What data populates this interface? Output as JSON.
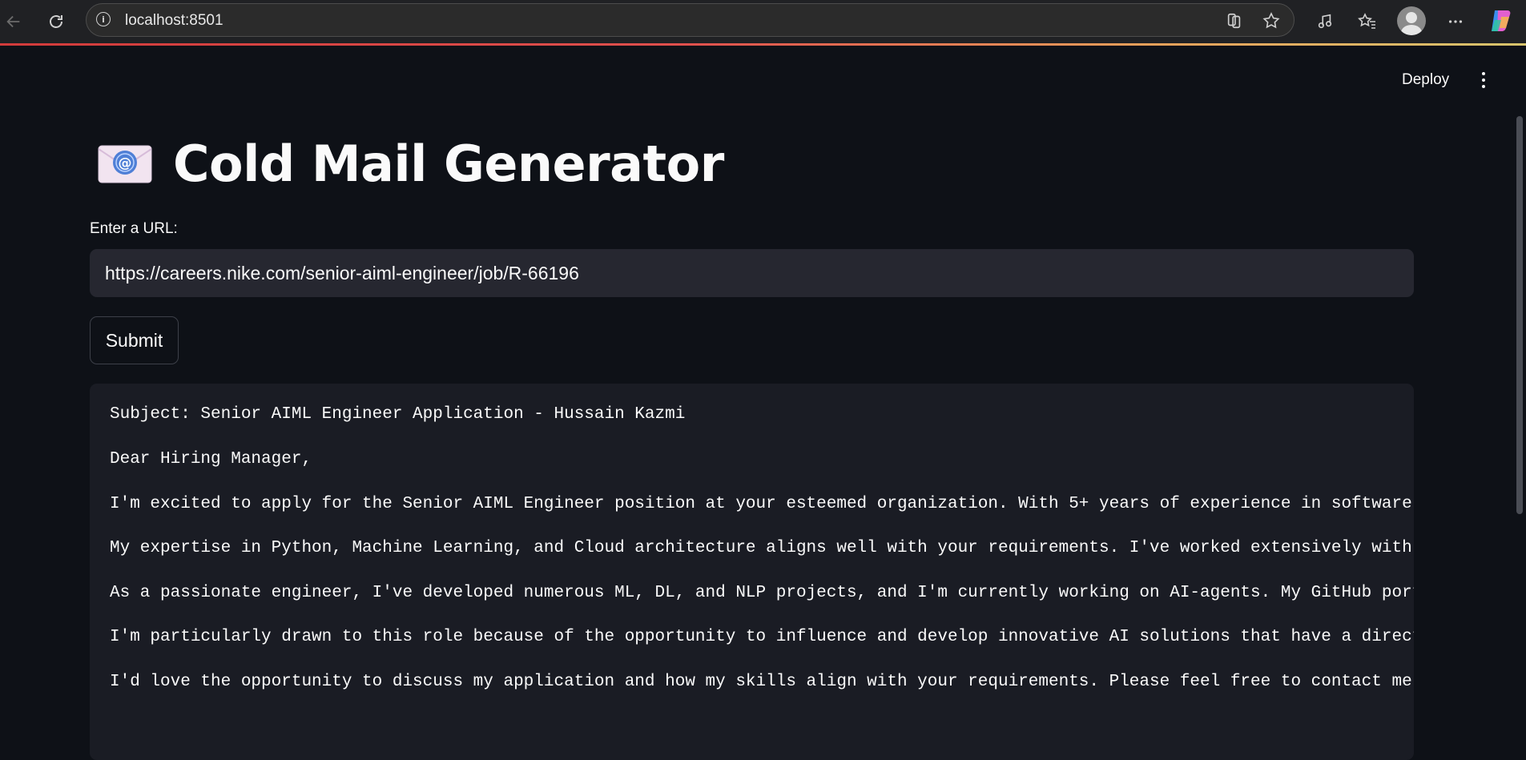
{
  "browser": {
    "url": "localhost:8501",
    "info_glyph": "i"
  },
  "header": {
    "deploy_label": "Deploy"
  },
  "main": {
    "title_emoji": "envelope-with-arrow",
    "title": "Cold Mail Generator",
    "url_label": "Enter a URL:",
    "url_value": "https://careers.nike.com/senior-aiml-engineer/job/R-66196",
    "submit_label": "Submit",
    "email_lines": [
      "Subject: Senior AIML Engineer Application - Hussain Kazmi",
      "Dear Hiring Manager,",
      "I'm excited to apply for the Senior AIML Engineer position at your esteemed organization. With 5+ years of experience in software",
      "My expertise in Python, Machine Learning, and Cloud architecture aligns well with your requirements. I've worked extensively with",
      "As a passionate engineer, I've developed numerous ML, DL, and NLP projects, and I'm currently working on AI-agents. My GitHub port",
      "I'm particularly drawn to this role because of the opportunity to influence and develop innovative AI solutions that have a direct",
      "I'd love the opportunity to discuss my application and how my skills align with your requirements. Please feel free to contact me"
    ]
  },
  "colors": {
    "page_bg": "#0e1117",
    "input_bg": "#262730",
    "code_bg": "#1a1c24",
    "text": "#fafafa",
    "accent_line": "#e0504d"
  }
}
